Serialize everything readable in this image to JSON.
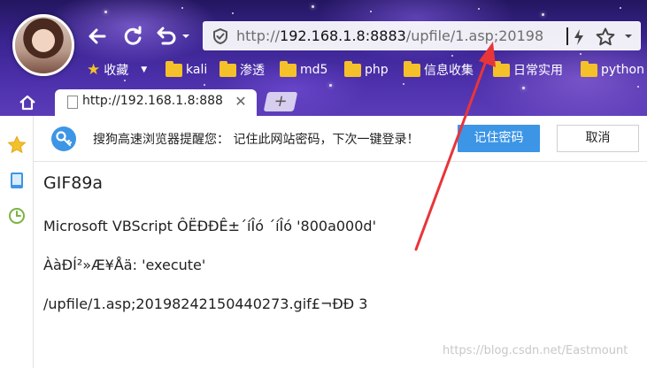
{
  "toolbar": {
    "back_icon": "arrow-left",
    "refresh_icon": "refresh",
    "undo_icon": "undo"
  },
  "address_bar": {
    "url_prefix": "http://",
    "url_host": "192.168.1.8:8883",
    "url_path": "/upfile/1.asp;20198",
    "security_icon": "shield"
  },
  "bookmarks": {
    "favorites_label": "收藏",
    "items": [
      {
        "label": "kali"
      },
      {
        "label": "渗透"
      },
      {
        "label": "md5"
      },
      {
        "label": "php"
      },
      {
        "label": "信息收集"
      },
      {
        "label": "日常实用"
      },
      {
        "label": "python"
      }
    ]
  },
  "tabs": [
    {
      "title": "http://192.168.1.8:888"
    }
  ],
  "notification": {
    "message": "搜狗高速浏览器提醒您： 记住此网站密码，下次一键登录！",
    "save_label": "记住密码",
    "cancel_label": "取消"
  },
  "page": {
    "line1": "GIF89a",
    "line2": "Microsoft VBScript ÔËÐÐÊ±´íÎó  ´íÎó '800a000d'",
    "line3": "ÀàÐÍ²»Æ¥Åä: 'execute'",
    "line4": "/upfile/1.asp;20198242150440273.gif£¬ÐÐ 3"
  },
  "watermark": "https://blog.csdn.net/Eastmount",
  "colors": {
    "accent": "#3d95e6",
    "annotation_arrow": "#e8353a",
    "bookmark_folder": "#f5c12a"
  }
}
